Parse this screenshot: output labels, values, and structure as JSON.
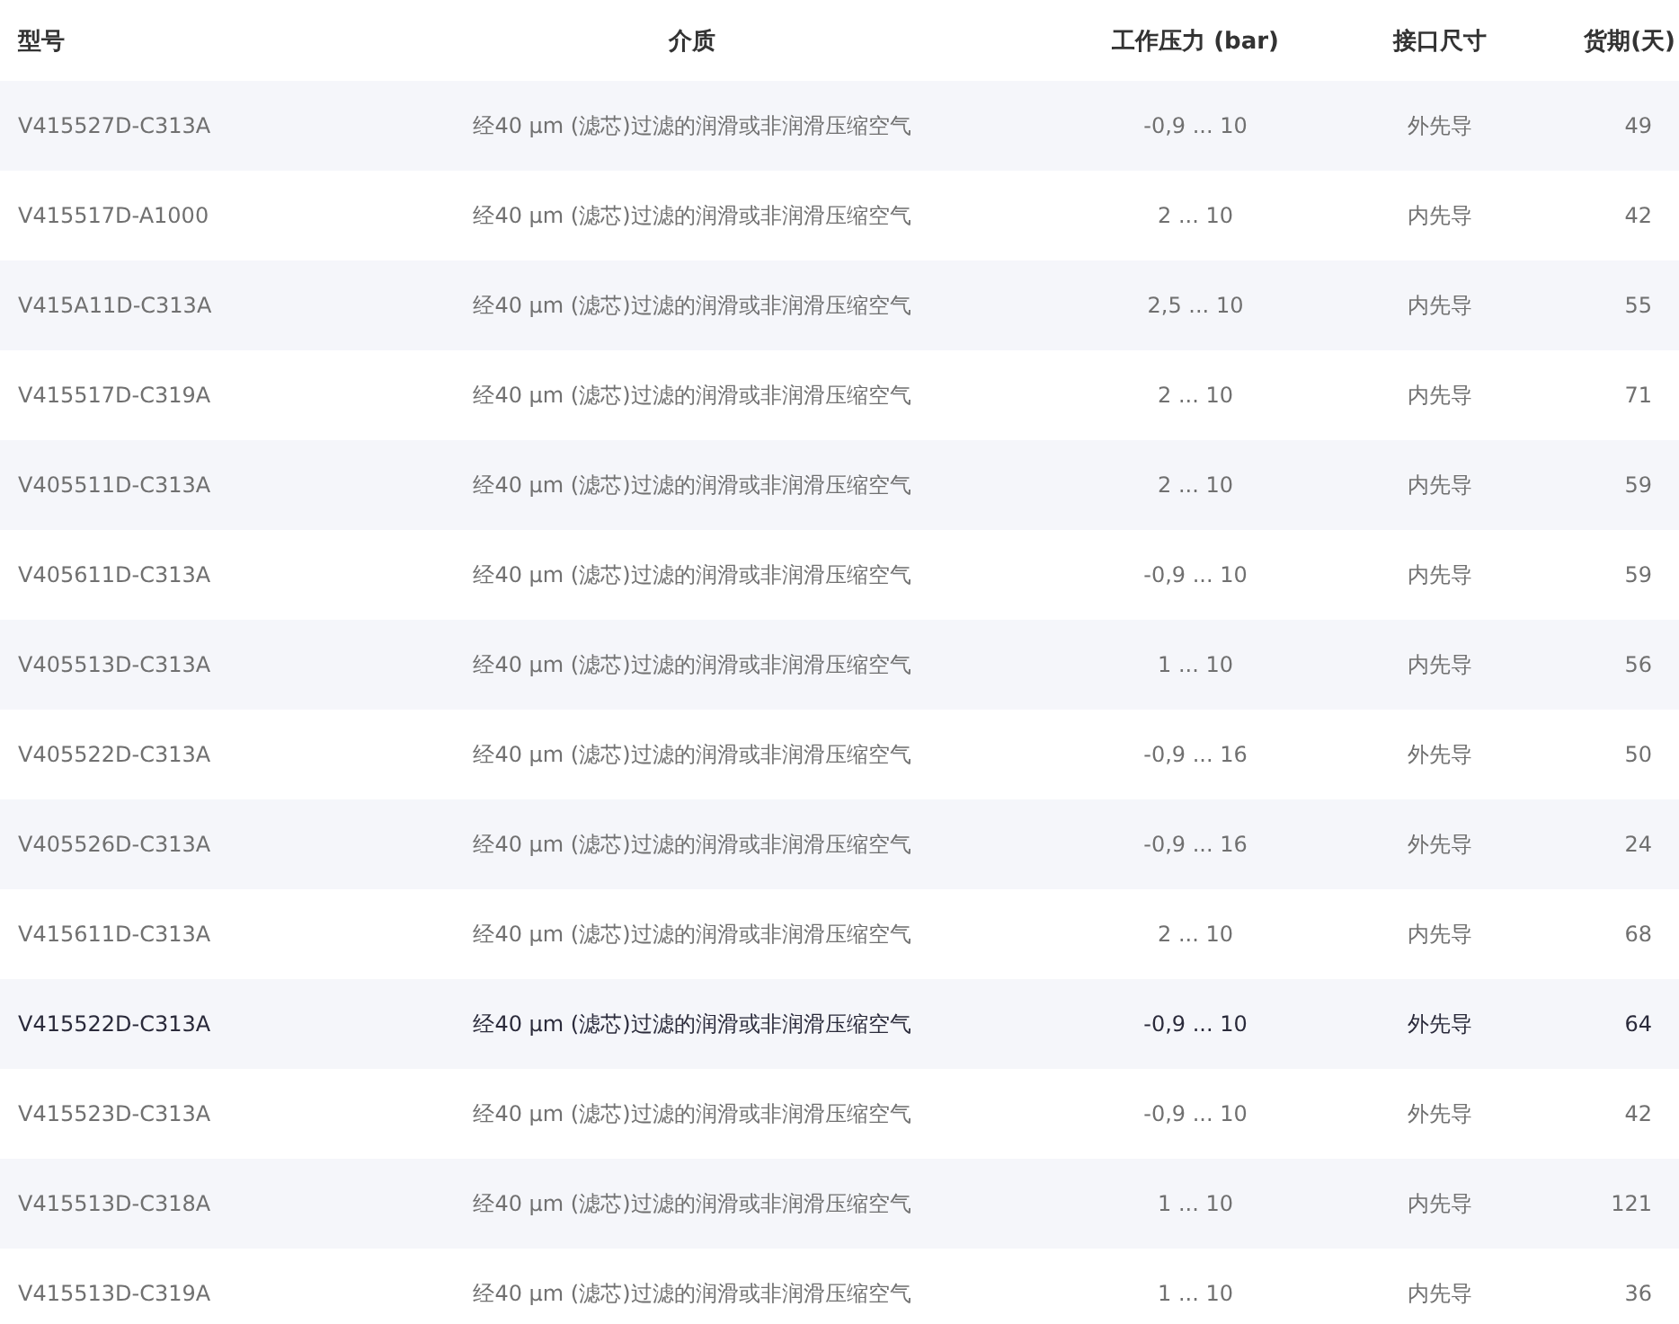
{
  "table": {
    "columns": [
      "型号",
      "介质",
      "工作压力 (bar)",
      "接口尺寸",
      "货期(天)"
    ],
    "rows": [
      {
        "model": "V415527D-C313A",
        "medium": "经40 μm (滤芯)过滤的润滑或非润滑压缩空气",
        "pressure": "-0,9 ... 10",
        "port": "外先导",
        "lead_time": "49",
        "selected": false
      },
      {
        "model": "V415517D-A1000",
        "medium": "经40 μm (滤芯)过滤的润滑或非润滑压缩空气",
        "pressure": "2 ... 10",
        "port": "内先导",
        "lead_time": "42",
        "selected": false
      },
      {
        "model": "V415A11D-C313A",
        "medium": "经40 μm (滤芯)过滤的润滑或非润滑压缩空气",
        "pressure": "2,5 ... 10",
        "port": "内先导",
        "lead_time": "55",
        "selected": false
      },
      {
        "model": "V415517D-C319A",
        "medium": "经40 μm (滤芯)过滤的润滑或非润滑压缩空气",
        "pressure": "2 ... 10",
        "port": "内先导",
        "lead_time": "71",
        "selected": false
      },
      {
        "model": "V405511D-C313A",
        "medium": "经40 μm (滤芯)过滤的润滑或非润滑压缩空气",
        "pressure": "2 ... 10",
        "port": "内先导",
        "lead_time": "59",
        "selected": false
      },
      {
        "model": "V405611D-C313A",
        "medium": "经40 μm (滤芯)过滤的润滑或非润滑压缩空气",
        "pressure": "-0,9 ... 10",
        "port": "内先导",
        "lead_time": "59",
        "selected": false
      },
      {
        "model": "V405513D-C313A",
        "medium": "经40 μm (滤芯)过滤的润滑或非润滑压缩空气",
        "pressure": "1 ... 10",
        "port": "内先导",
        "lead_time": "56",
        "selected": false
      },
      {
        "model": "V405522D-C313A",
        "medium": "经40 μm (滤芯)过滤的润滑或非润滑压缩空气",
        "pressure": "-0,9 ... 16",
        "port": "外先导",
        "lead_time": "50",
        "selected": false
      },
      {
        "model": "V405526D-C313A",
        "medium": "经40 μm (滤芯)过滤的润滑或非润滑压缩空气",
        "pressure": "-0,9 ... 16",
        "port": "外先导",
        "lead_time": "24",
        "selected": false
      },
      {
        "model": "V415611D-C313A",
        "medium": "经40 μm (滤芯)过滤的润滑或非润滑压缩空气",
        "pressure": "2 ... 10",
        "port": "内先导",
        "lead_time": "68",
        "selected": false
      },
      {
        "model": "V415522D-C313A",
        "medium": "经40 μm (滤芯)过滤的润滑或非润滑压缩空气",
        "pressure": "-0,9 ... 10",
        "port": "外先导",
        "lead_time": "64",
        "selected": true
      },
      {
        "model": "V415523D-C313A",
        "medium": "经40 μm (滤芯)过滤的润滑或非润滑压缩空气",
        "pressure": "-0,9 ... 10",
        "port": "外先导",
        "lead_time": "42",
        "selected": false
      },
      {
        "model": "V415513D-C318A",
        "medium": "经40 μm (滤芯)过滤的润滑或非润滑压缩空气",
        "pressure": "1 ... 10",
        "port": "内先导",
        "lead_time": "121",
        "selected": false
      },
      {
        "model": "V415513D-C319A",
        "medium": "经40 μm (滤芯)过滤的润滑或非润滑压缩空气",
        "pressure": "1 ... 10",
        "port": "内先导",
        "lead_time": "36",
        "selected": false
      }
    ]
  }
}
